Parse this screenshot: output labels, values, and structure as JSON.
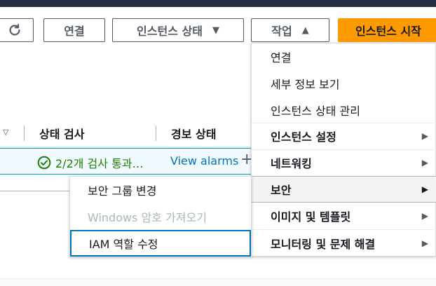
{
  "toolbar": {
    "connect_label": "연결",
    "instance_state_label": "인스턴스 상태",
    "actions_label": "작업",
    "launch_label": "인스턴스 시작"
  },
  "table": {
    "columns": [
      "상태 검사",
      "경보 상태"
    ],
    "row": {
      "status_check": "2/2개 검사 통과…",
      "alarm_link": "View alarms",
      "plus_symbol": "+"
    }
  },
  "actions_menu": {
    "items": [
      {
        "label": "연결"
      },
      {
        "label": "세부 정보 보기"
      },
      {
        "label": "인스턴스 상태 관리"
      },
      {
        "label": "인스턴스 설정"
      },
      {
        "label": "네트워킹"
      },
      {
        "label": "보안"
      },
      {
        "label": "이미지 및 템플릿"
      },
      {
        "label": "모니터링 및 문제 해결"
      }
    ],
    "submenu_arrow": "▶"
  },
  "security_submenu": {
    "items": [
      {
        "label": "보안 그룹 변경"
      },
      {
        "label": "Windows 암호 가져오기"
      },
      {
        "label": "IAM 역할 수정"
      }
    ]
  },
  "icons": {
    "caret_down": "▼",
    "caret_up": "▲",
    "sort_caret": "▽"
  },
  "colors": {
    "primary_orange": "#ff9900",
    "link_blue": "#0073bb",
    "success_green": "#1d8102"
  }
}
